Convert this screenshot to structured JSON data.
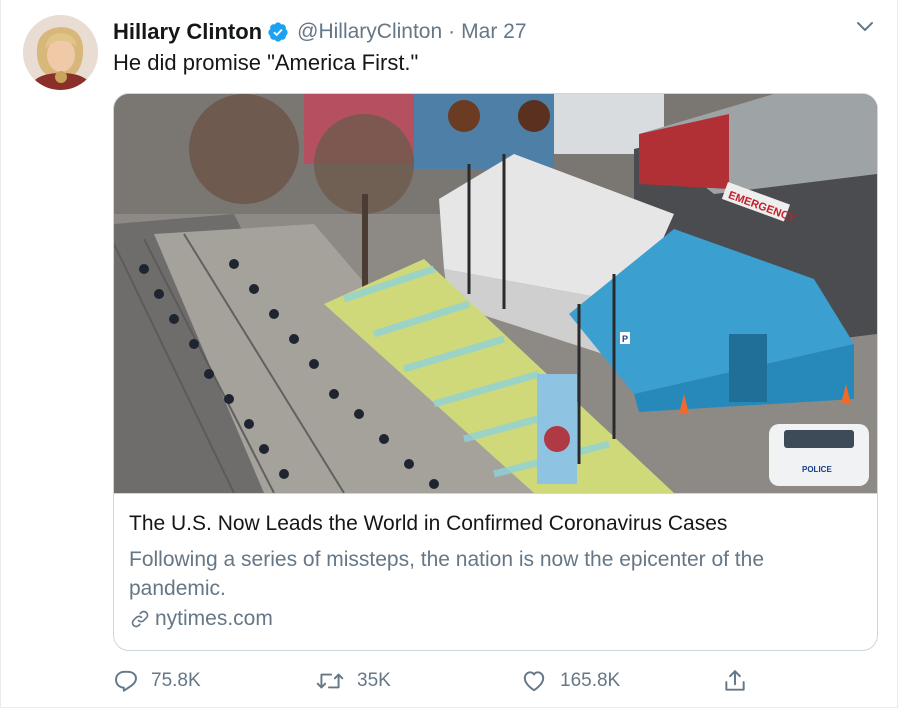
{
  "tweet": {
    "author_name": "Hillary Clinton",
    "handle": "@HillaryClinton",
    "separator": "·",
    "date": "Mar 27",
    "text": "He did promise \"America First.\""
  },
  "card": {
    "title": "The U.S. Now Leads the World in Confirmed Coronavirus Cases",
    "description": "Following a series of missteps, the nation is now the epicenter of the pandemic.",
    "domain": "nytimes.com",
    "image_signs": {
      "emergency": "EMERGENCY",
      "police": "POLICE",
      "parking": "P"
    }
  },
  "actions": {
    "replies": "75.8K",
    "retweets": "35K",
    "likes": "165.8K"
  },
  "icons": {
    "verified": "verified-badge-icon",
    "more": "chevron-down-icon",
    "link": "link-icon",
    "reply": "reply-icon",
    "retweet": "retweet-icon",
    "like": "heart-icon",
    "share": "share-icon"
  },
  "colors": {
    "brand_blue": "#1da1f2",
    "text": "#14171a",
    "secondary": "#657786",
    "border": "#ccd6dd"
  }
}
